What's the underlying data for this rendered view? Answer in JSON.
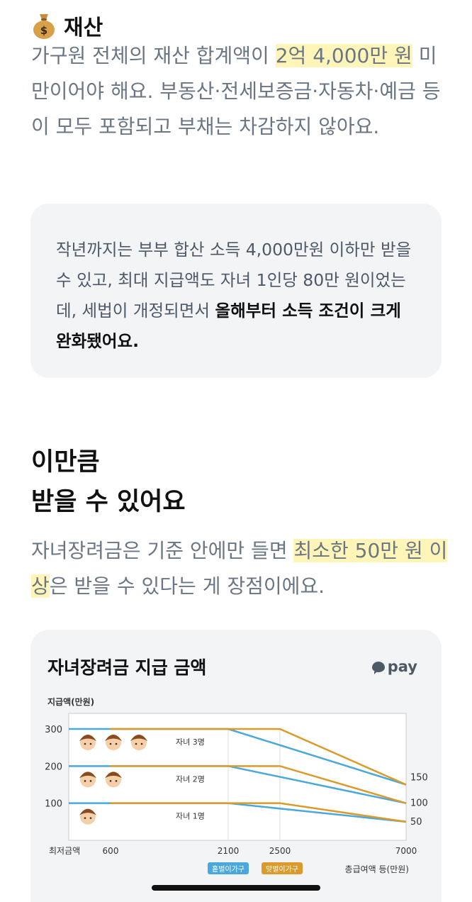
{
  "section": {
    "icon": "moneybag-icon",
    "title": "재산"
  },
  "para1": {
    "t1": "가구원 전체의 재산 합계액이 ",
    "h1": "2억 4,000만 원",
    "t2": " 미만이어야 해요. 부동산·전세보증금·자동차·예금 등이 모두 포함되고 부채는 차감하지 않아요."
  },
  "callout": {
    "t1": "작년까지는 부부 합산 소득 4,000만원 이하만 받을 수 있고, 최대 지급액도 자녀 1인당 80만 원이었는데, 세법이 개정되면서 ",
    "strong": "올해부터 소득 조건이 크게 완화됐어요."
  },
  "heading": {
    "line1": "이만큼",
    "line2": "받을 수 있어요"
  },
  "para2": {
    "t1": "자녀장려금은 기준 안에만 들면 ",
    "h1": "최소한 50만 원 이상",
    "t2": "은 받을 수 있다는 게 장점이에요."
  },
  "chart_card": {
    "title": "자녀장려금 지급 금액",
    "logo": "pay"
  },
  "chart_data": {
    "type": "line",
    "ylabel": "지급액(만원)",
    "xlabel": "총급여액 등(만원)",
    "ylim": [
      0,
      330
    ],
    "x_ticks": [
      "최저금액",
      "600",
      "2100",
      "2500",
      "7000"
    ],
    "y_ticks": [
      "100",
      "200",
      "300"
    ],
    "right_labels": [
      "150",
      "100",
      "50"
    ],
    "legend": [
      {
        "label": "홑벌이가구",
        "color": "#4aa8dc"
      },
      {
        "label": "맞벌이가구",
        "color": "#dc9a2b"
      }
    ],
    "groups": [
      {
        "label": "자녀 3명",
        "children": 3
      },
      {
        "label": "자녀 2명",
        "children": 2
      },
      {
        "label": "자녀 1명",
        "children": 1
      }
    ],
    "series": [
      {
        "name": "홑벌이가구",
        "color": "#4aa8dc",
        "lines": [
          {
            "group": "자녀 3명",
            "x": [
              0,
              2100,
              7000
            ],
            "y": [
              300,
              300,
              150
            ]
          },
          {
            "group": "자녀 2명",
            "x": [
              0,
              2100,
              7000
            ],
            "y": [
              200,
              200,
              100
            ]
          },
          {
            "group": "자녀 1명",
            "x": [
              0,
              2100,
              7000
            ],
            "y": [
              100,
              100,
              50
            ]
          }
        ]
      },
      {
        "name": "맞벌이가구",
        "color": "#dc9a2b",
        "lines": [
          {
            "group": "자녀 3명",
            "x": [
              600,
              2500,
              7000
            ],
            "y": [
              300,
              300,
              150
            ]
          },
          {
            "group": "자녀 2명",
            "x": [
              600,
              2500,
              7000
            ],
            "y": [
              200,
              200,
              100
            ]
          },
          {
            "group": "자녀 1명",
            "x": [
              600,
              2500,
              7000
            ],
            "y": [
              100,
              100,
              50
            ]
          }
        ]
      }
    ]
  }
}
